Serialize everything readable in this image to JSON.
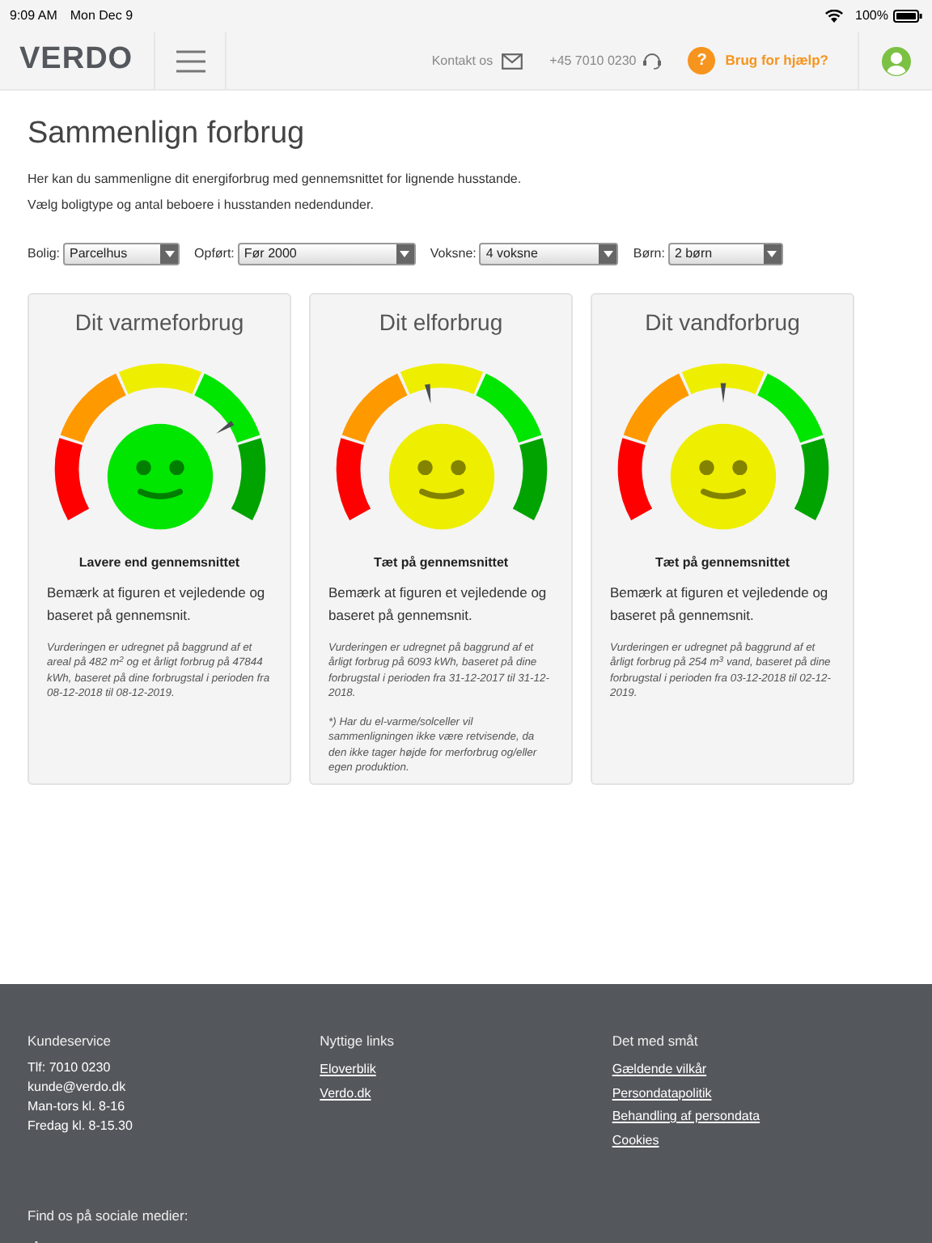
{
  "status_bar": {
    "time": "9:09 AM",
    "date": "Mon Dec 9",
    "battery": "100%"
  },
  "header": {
    "logo": "VERDO",
    "contact": "Kontakt os",
    "phone": "+45 7010 0230",
    "help_badge": "?",
    "help": "Brug for hjælp?"
  },
  "page": {
    "title": "Sammenlign forbrug",
    "intro": [
      "Her kan du sammenligne dit energiforbrug med gennemsnittet for lignende husstande.",
      "Vælg boligtype og antal beboere i husstanden nedendunder."
    ]
  },
  "filters": [
    {
      "label": "Bolig:",
      "value": "Parcelhus"
    },
    {
      "label": "Opført:",
      "value": "Før 2000"
    },
    {
      "label": "Voksne:",
      "value": "4 voksne"
    },
    {
      "label": "Børn:",
      "value": "2 børn"
    }
  ],
  "cards": [
    {
      "title": "Dit varmeforbrug",
      "level": 0.74,
      "color": "#00e600",
      "verdict": "Lavere end gennemsnittet",
      "note": "Bemærk at figuren et vejledende og baseret på gennemsnit.",
      "details": [
        "Vurderingen er udregnet på baggrund af et areal på 482 m$^{2}$ og et årligt forbrug på 47844 kWh, baseret på dine forbrugstal i perioden fra 08-12-2018 til 08-12-2019."
      ]
    },
    {
      "title": "Dit elforbrug",
      "level": 0.46,
      "color": "#eeee00",
      "verdict": "Tæt på gennemsnittet",
      "note": "Bemærk at figuren et vejledende og baseret på gennemsnit.",
      "details": [
        "Vurderingen er udregnet på baggrund af et årligt forbrug på 6093 kWh, baseret på dine forbrugstal i perioden fra 31-12-2017 til 31-12-2018.",
        "*) Har du el-varme/solceller vil sammenligningen ikke være retvisende, da den ikke tager højde for merforbrug og/eller egen produktion."
      ]
    },
    {
      "title": "Dit vandforbrug",
      "level": 0.5,
      "color": "#eeee00",
      "verdict": "Tæt på gennemsnittet",
      "note": "Bemærk at figuren et vejledende og baseret på gennemsnit.",
      "details": [
        "Vurderingen er udregnet på baggrund af et årligt forbrug på 254 m$^{3}$ vand, baseret på dine forbrugstal i perioden fra 03-12-2018 til 02-12-2019."
      ]
    }
  ],
  "footer": {
    "columns": [
      {
        "heading": "Kundeservice",
        "kind": "text",
        "lines": [
          "Tlf: 7010 0230",
          "kunde@verdo.dk",
          "Man-tors kl. 8-16",
          "Fredag kl. 8-15.30"
        ]
      },
      {
        "heading": "Nyttige links",
        "kind": "links",
        "lines": [
          "Eloverblik",
          "Verdo.dk"
        ]
      },
      {
        "heading": "Det med småt",
        "kind": "links",
        "lines": [
          "Gældende vilkår",
          "Persondatapolitik",
          "Behandling af persondata",
          "Cookies"
        ]
      }
    ],
    "social_heading": "Find os på sociale medier:"
  }
}
